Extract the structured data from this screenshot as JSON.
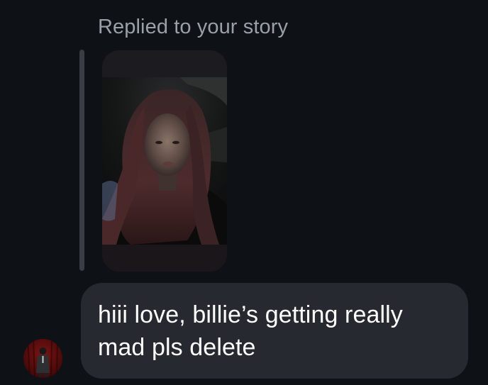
{
  "reply": {
    "label": "Replied to your story"
  },
  "story": {
    "image": "story-photo-person-selfie"
  },
  "message": {
    "text": "hiii love, billie’s getting really mad pls delete",
    "bubble_color": "#26292f",
    "text_color": "#ffffff"
  },
  "sender": {
    "avatar": "sender-avatar"
  },
  "colors": {
    "background": "#0e1116",
    "secondary_text": "#9aa0a8",
    "reply_bar": "#3a3d44"
  }
}
